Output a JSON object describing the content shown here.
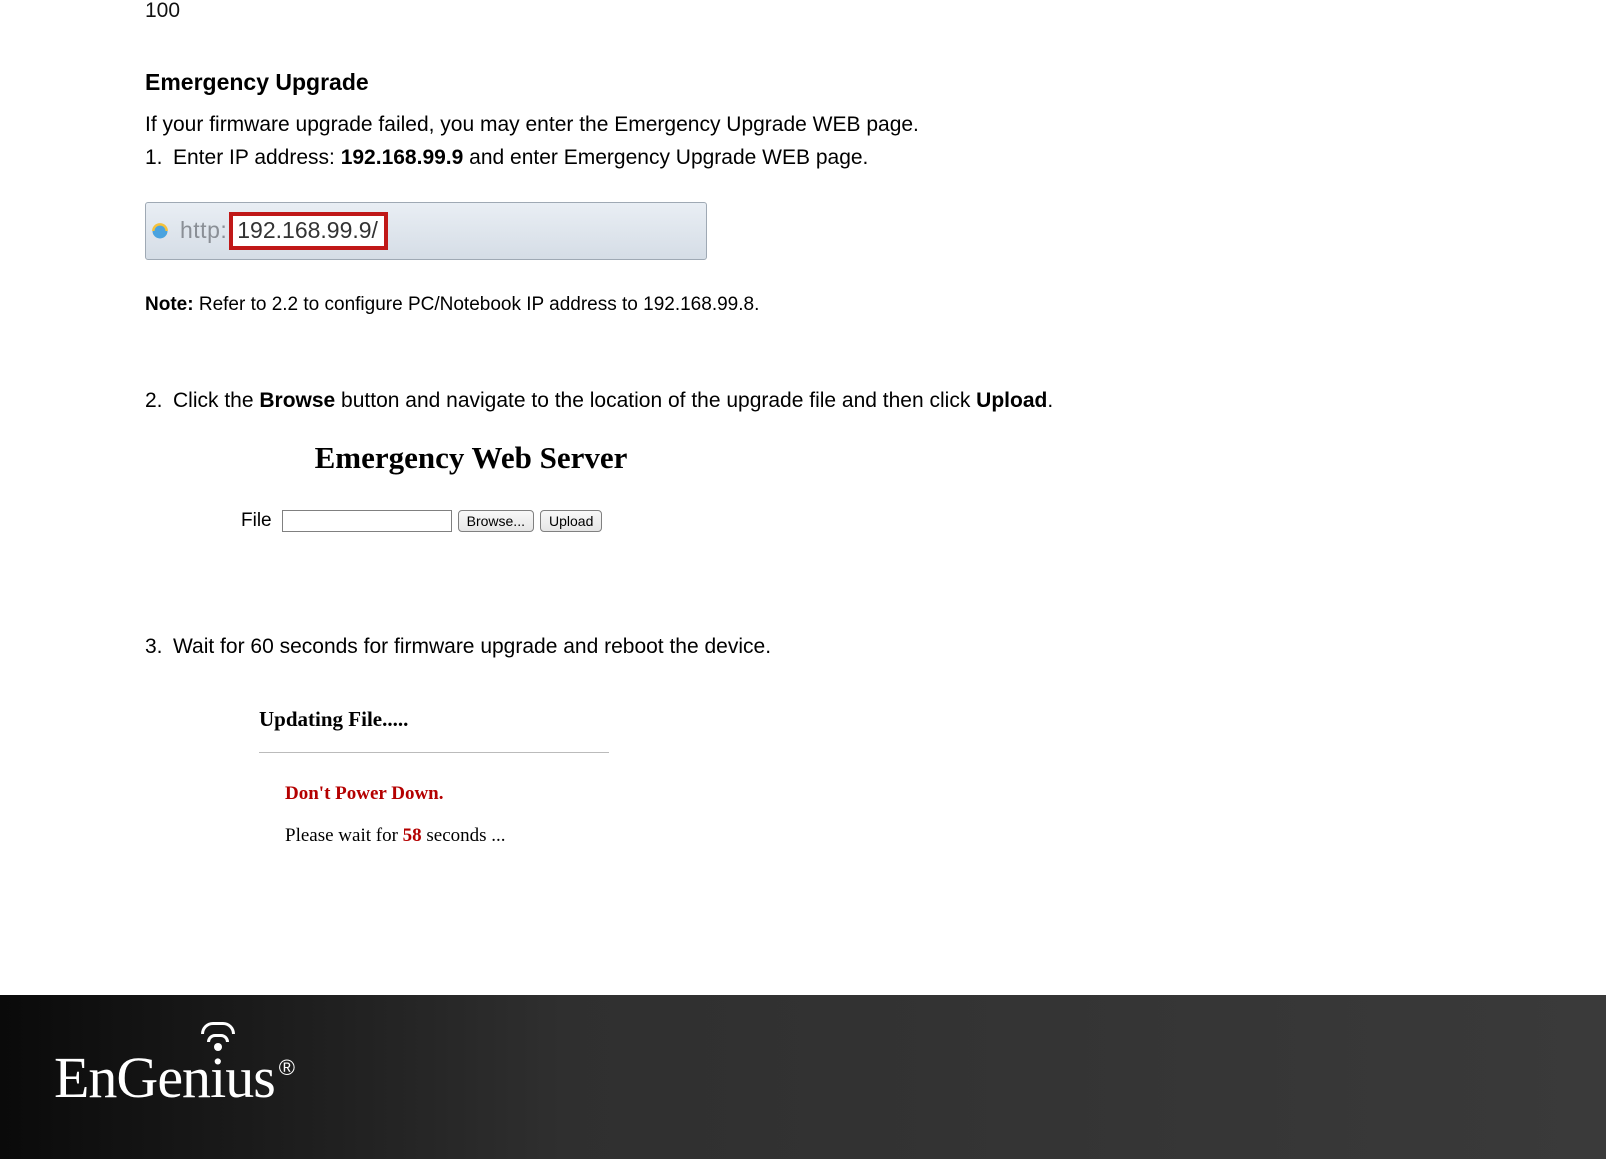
{
  "page_number": "100",
  "section_title": "Emergency Upgrade",
  "intro": "If your firmware upgrade failed, you may enter the Emergency Upgrade WEB page.",
  "step1": {
    "num": "1.",
    "pre": "Enter IP address: ",
    "ip": "192.168.99.9",
    "post": " and enter Emergency Upgrade WEB page."
  },
  "fig1": {
    "http_label": "http:",
    "address": "192.168.99.9/"
  },
  "note": {
    "label": "Note:",
    "text": " Refer to 2.2 to configure PC/Notebook IP address to 192.168.99.8."
  },
  "step2": {
    "num": "2.",
    "pre": "Click the ",
    "b1": "Browse",
    "mid": " button and navigate to the location of the upgrade file and then click ",
    "b2": "Upload",
    "post": "."
  },
  "fig2": {
    "title": "Emergency Web Server",
    "file_label": "File",
    "browse_btn": "Browse...",
    "upload_btn": "Upload",
    "file_value": ""
  },
  "step3": {
    "num": "3.",
    "text": "Wait for 60 seconds for firmware upgrade and reboot the device."
  },
  "fig3": {
    "updating": "Updating File.....",
    "dont": "Don't Power Down.",
    "wait_pre": "Please wait for ",
    "seconds": "58",
    "wait_post": " seconds ..."
  },
  "footer": {
    "logo_text_1": "EnGen",
    "logo_text_2": "i",
    "logo_text_3": "us",
    "reg": "®"
  }
}
